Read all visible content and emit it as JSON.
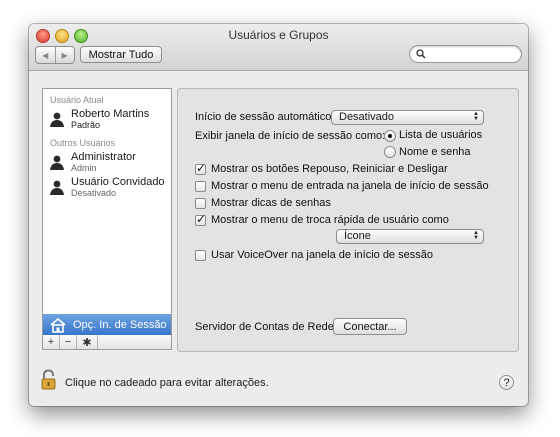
{
  "window": {
    "title": "Usuários e Grupos"
  },
  "toolbar": {
    "back_icon": "◀",
    "forward_icon": "▶",
    "show_all_label": "Mostrar Tudo",
    "search_placeholder": ""
  },
  "sidebar": {
    "current_user_header": "Usuário Atual",
    "current_user": {
      "name": "Roberto Martins",
      "role": "Padrão"
    },
    "other_users_header": "Outros Usuários",
    "other_users": [
      {
        "name": "Administrator",
        "role": "Admin"
      },
      {
        "name": "Usuário Convidado",
        "role": "Desativado"
      }
    ],
    "login_options_label": "Opç. In. de Sessão",
    "add_label": "+",
    "remove_label": "−",
    "action_label": "✱"
  },
  "panel": {
    "auto_login_label": "Início de sessão automático:",
    "auto_login_value": "Desativado",
    "display_login_label": "Exibir janela de início de sessão como:",
    "display_options": [
      "Lista de usuários",
      "Nome e senha"
    ],
    "display_selected": "Lista de usuários",
    "checkboxes": [
      {
        "label": "Mostrar os botões Repouso, Reiniciar e Desligar",
        "checked": true
      },
      {
        "label": "Mostrar o menu de entrada na janela de início de sessão",
        "checked": false
      },
      {
        "label": "Mostrar dicas de senhas",
        "checked": false
      },
      {
        "label": "Mostrar o menu de troca rápida de usuário como",
        "checked": true
      }
    ],
    "fast_switch_value": "Ícone",
    "voiceover_label": "Usar VoiceOver na janela de início de sessão",
    "voiceover_checked": false,
    "network_server_label": "Servidor de Contas de Rede:",
    "connect_label": "Conectar..."
  },
  "footer": {
    "lock_text": "Clique no cadeado para evitar alterações.",
    "help_label": "?"
  }
}
